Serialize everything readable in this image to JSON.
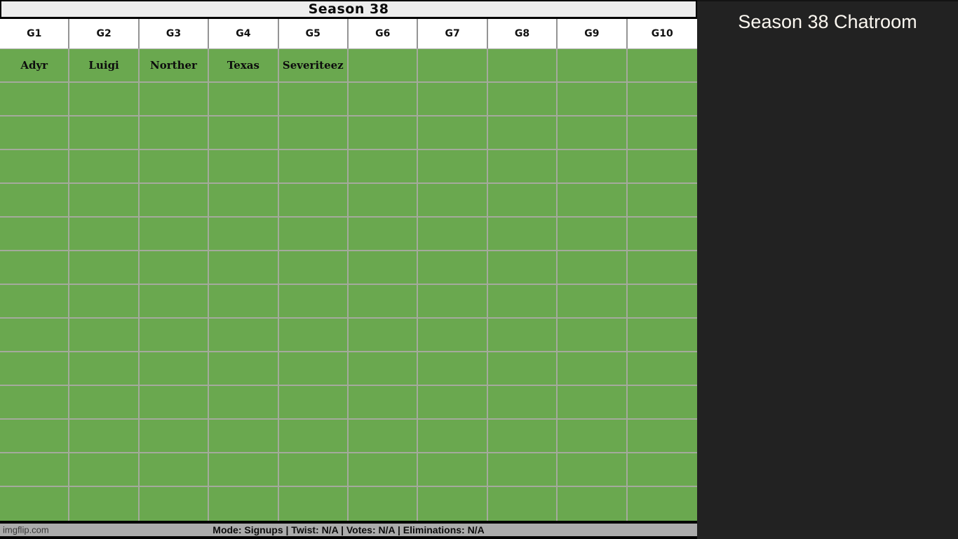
{
  "table": {
    "title": "Season 38",
    "columns": [
      "G1",
      "G2",
      "G3",
      "G4",
      "G5",
      "G6",
      "G7",
      "G8",
      "G9",
      "G10"
    ],
    "rows": [
      [
        "Adyr",
        "Luigi",
        "Norther",
        "Texas",
        "Severiteez",
        "",
        "",
        "",
        "",
        ""
      ],
      [
        "",
        "",
        "",
        "",
        "",
        "",
        "",
        "",
        "",
        ""
      ],
      [
        "",
        "",
        "",
        "",
        "",
        "",
        "",
        "",
        "",
        ""
      ],
      [
        "",
        "",
        "",
        "",
        "",
        "",
        "",
        "",
        "",
        ""
      ],
      [
        "",
        "",
        "",
        "",
        "",
        "",
        "",
        "",
        "",
        ""
      ],
      [
        "",
        "",
        "",
        "",
        "",
        "",
        "",
        "",
        "",
        ""
      ],
      [
        "",
        "",
        "",
        "",
        "",
        "",
        "",
        "",
        "",
        ""
      ],
      [
        "",
        "",
        "",
        "",
        "",
        "",
        "",
        "",
        "",
        ""
      ],
      [
        "",
        "",
        "",
        "",
        "",
        "",
        "",
        "",
        "",
        ""
      ],
      [
        "",
        "",
        "",
        "",
        "",
        "",
        "",
        "",
        "",
        ""
      ],
      [
        "",
        "",
        "",
        "",
        "",
        "",
        "",
        "",
        "",
        ""
      ],
      [
        "",
        "",
        "",
        "",
        "",
        "",
        "",
        "",
        "",
        ""
      ],
      [
        "",
        "",
        "",
        "",
        "",
        "",
        "",
        "",
        "",
        ""
      ],
      [
        "",
        "",
        "",
        "",
        "",
        "",
        "",
        "",
        "",
        ""
      ]
    ]
  },
  "chatroom": {
    "title": "Season 38 Chatroom"
  },
  "footer": {
    "status": "Mode: Signups | Twist: N/A | Votes: N/A | Eliminations: N/A"
  },
  "watermark": "imgflip.com",
  "colors": {
    "cell_green": "#6aa84f",
    "grid_line": "#a4aa9c",
    "panel_dark": "#222222",
    "footer_gray": "#ababab",
    "title_bar_bg": "#ededed"
  }
}
